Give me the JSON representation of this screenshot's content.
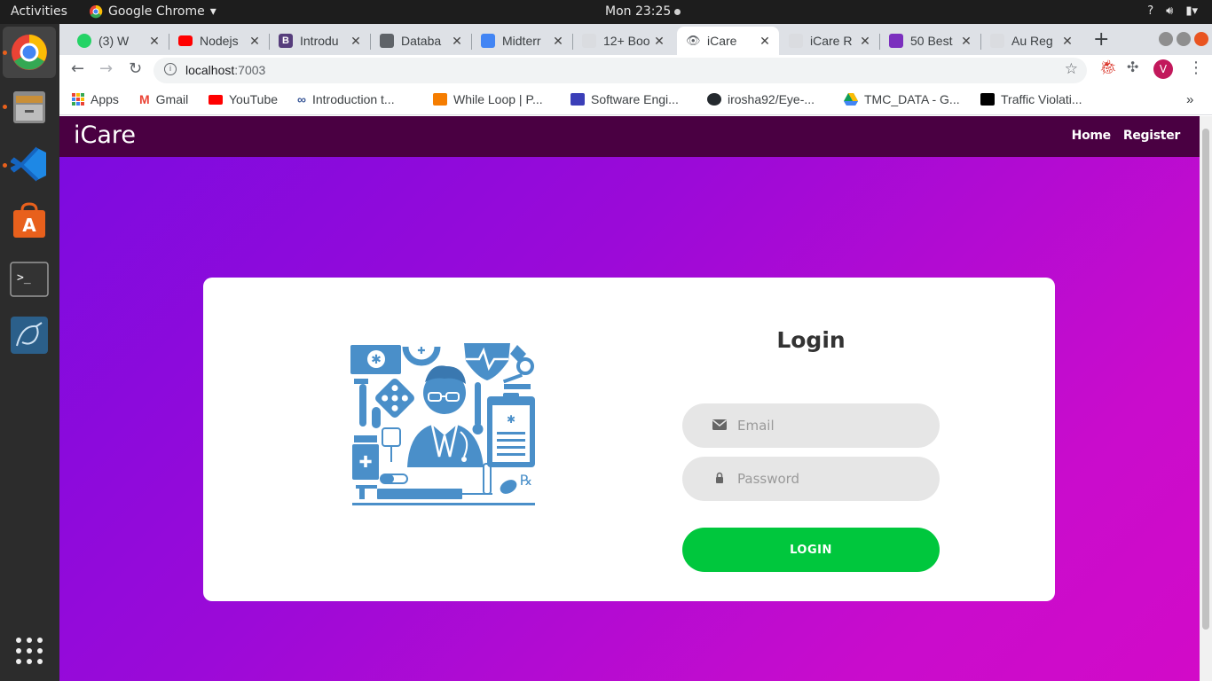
{
  "system": {
    "activities": "Activities",
    "app_name": "Google Chrome",
    "clock": "Mon 23:25",
    "tray_icons": [
      "help-icon",
      "volume-icon",
      "battery-icon"
    ]
  },
  "dock": {
    "items": [
      {
        "name": "chrome-icon",
        "color": "#4285f4"
      },
      {
        "name": "files-icon",
        "color": "#8a8a8a"
      },
      {
        "name": "vscode-icon",
        "color": "#1e88e5"
      },
      {
        "name": "software-center-icon",
        "color": "#e8601c"
      },
      {
        "name": "terminal-icon",
        "color": "#333333"
      },
      {
        "name": "mysql-workbench-icon",
        "color": "#2b5f8a"
      }
    ],
    "apps_grid_icon": "grid-icon"
  },
  "browser": {
    "tabs": [
      {
        "title": "(3) W",
        "icon": "whatsapp-icon",
        "color": "#25d366"
      },
      {
        "title": "Nodejs",
        "icon": "youtube-icon",
        "color": "#ff0000"
      },
      {
        "title": "Introdu",
        "icon": "bootstrap-icon",
        "color": "#563d7c"
      },
      {
        "title": "Databa",
        "icon": "contact-icon",
        "color": "#5f6368"
      },
      {
        "title": "Midterr",
        "icon": "docs-icon",
        "color": "#4285f4"
      },
      {
        "title": "12+ Boo",
        "icon": "page-icon",
        "color": "#dadce0"
      },
      {
        "title": "iCare",
        "icon": "eye-icon",
        "color": "#5f6368",
        "active": true
      },
      {
        "title": "iCare R",
        "icon": "page-icon",
        "color": "#dadce0"
      },
      {
        "title": "50 Best",
        "icon": "colorlib-icon",
        "color": "#7b2fbe"
      },
      {
        "title": "Au Reg",
        "icon": "page-icon",
        "color": "#dadce0"
      }
    ],
    "url_host": "localhost",
    "url_port": ":7003",
    "profile_initial": "V",
    "bookmarks": [
      {
        "label": "Apps",
        "icon": "apps-icon",
        "color": "#ea4335"
      },
      {
        "label": "Gmail",
        "icon": "gmail-icon",
        "color": "#ea4335"
      },
      {
        "label": "YouTube",
        "icon": "youtube-icon",
        "color": "#ff0000"
      },
      {
        "label": "Introduction t...",
        "icon": "link-icon",
        "color": "#3b5998"
      },
      {
        "label": "While Loop | P...",
        "icon": "blogger-icon",
        "color": "#f57d00"
      },
      {
        "label": "Software Engi...",
        "icon": "page-icon",
        "color": "#3b3fb8"
      },
      {
        "label": "irosha92/Eye-...",
        "icon": "github-icon",
        "color": "#24292e"
      },
      {
        "label": "TMC_DATA - G...",
        "icon": "drive-icon",
        "color": "#0f9d58"
      },
      {
        "label": "Traffic Violati...",
        "icon": "medium-icon",
        "color": "#000000"
      }
    ]
  },
  "site": {
    "brand": "iCare",
    "nav": {
      "home": "Home",
      "register": "Register"
    },
    "login": {
      "title": "Login",
      "email_placeholder": "Email",
      "password_placeholder": "Password",
      "button": "LOGIN"
    },
    "colors": {
      "navbar": "#4a0042",
      "gradient_start": "#7b0be0",
      "gradient_end": "#d20ac8",
      "button": "#00c73d",
      "illustration": "#4a8fc9"
    }
  }
}
